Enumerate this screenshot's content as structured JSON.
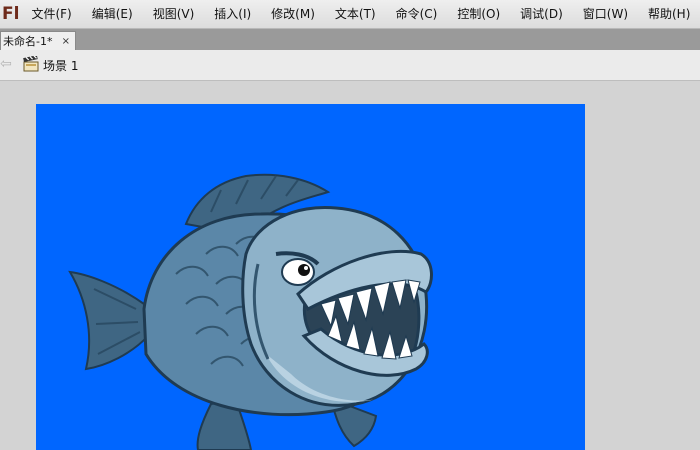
{
  "app": {
    "logo_text": "Fl"
  },
  "menu": [
    {
      "label": "文件(F)",
      "name": "menu-file"
    },
    {
      "label": "编辑(E)",
      "name": "menu-edit"
    },
    {
      "label": "视图(V)",
      "name": "menu-view"
    },
    {
      "label": "插入(I)",
      "name": "menu-insert"
    },
    {
      "label": "修改(M)",
      "name": "menu-modify"
    },
    {
      "label": "文本(T)",
      "name": "menu-text"
    },
    {
      "label": "命令(C)",
      "name": "menu-commands"
    },
    {
      "label": "控制(O)",
      "name": "menu-control"
    },
    {
      "label": "调试(D)",
      "name": "menu-debug"
    },
    {
      "label": "窗口(W)",
      "name": "menu-window"
    },
    {
      "label": "帮助(H)",
      "name": "menu-help"
    }
  ],
  "document_tab": {
    "title": "未命名-1*",
    "close_glyph": "×"
  },
  "edit_bar": {
    "back_icon": "back-arrow-icon",
    "scene_icon": "clapperboard-icon",
    "scene_label": "场景 1"
  },
  "stage": {
    "background_color": "#0066ff",
    "content": "piranha-fish-illustration"
  },
  "colors": {
    "fish_body": "#5b87a8",
    "fish_belly": "#8eb2c9",
    "fish_dark": "#33566f",
    "fin": "#3f6683"
  }
}
